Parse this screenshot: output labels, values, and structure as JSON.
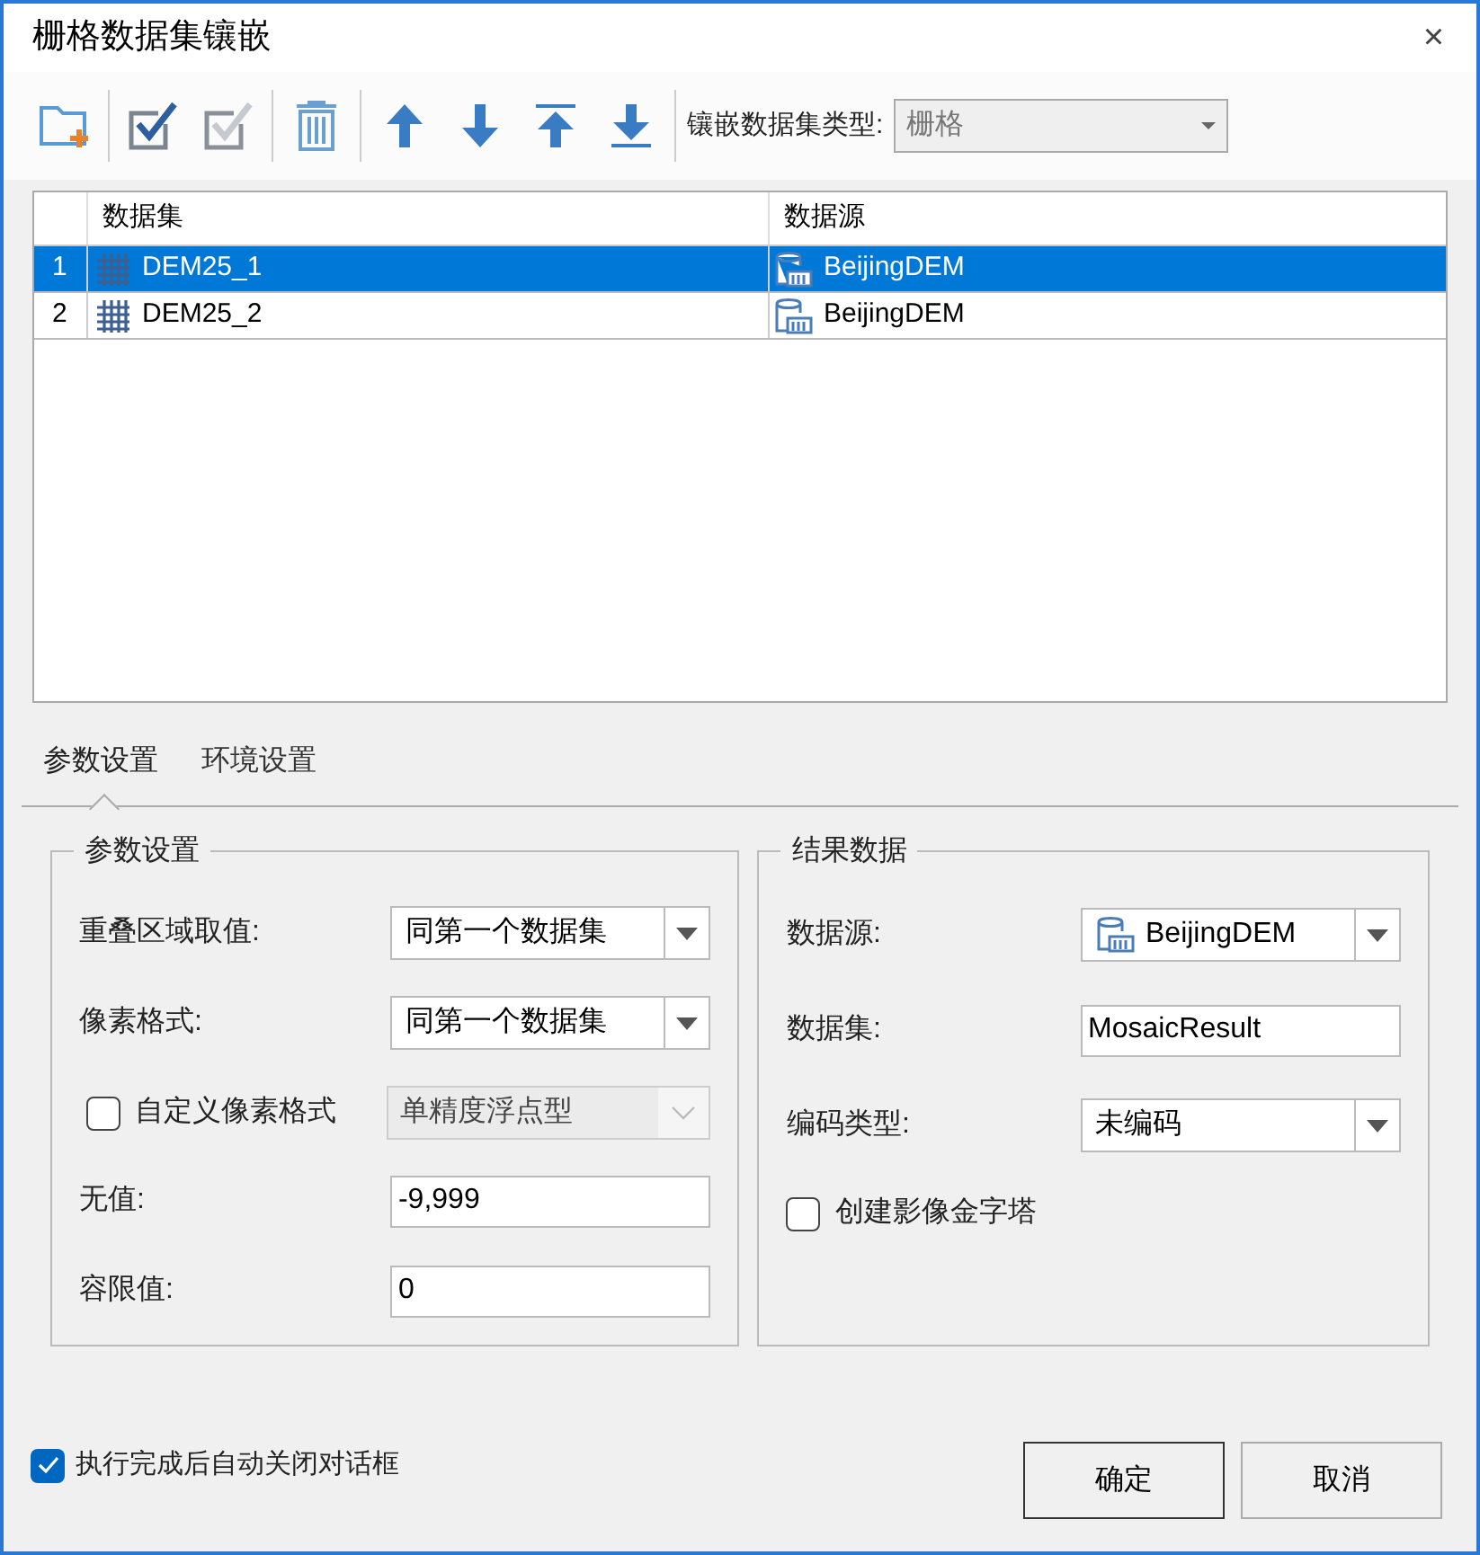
{
  "window": {
    "title": "栅格数据集镶嵌",
    "close": "×"
  },
  "toolbar": {
    "type_label": "镶嵌数据集类型:",
    "type_value": "栅格",
    "type_disabled": true
  },
  "table": {
    "columns": [
      "数据集",
      "数据源"
    ],
    "rows": [
      {
        "index": "1",
        "dataset": "DEM25_1",
        "datasource": "BeijingDEM",
        "selected": true
      },
      {
        "index": "2",
        "dataset": "DEM25_2",
        "datasource": "BeijingDEM",
        "selected": false
      }
    ]
  },
  "tabs": [
    {
      "label": "参数设置",
      "selected": true
    },
    {
      "label": "环境设置",
      "selected": false
    }
  ],
  "params": {
    "title": "参数设置",
    "fields": [
      {
        "kind": "dropdown",
        "label": "重叠区域取值:",
        "value": "同第一个数据集"
      },
      {
        "kind": "dropdown",
        "label": "像素格式:",
        "value": "同第一个数据集"
      },
      {
        "kind": "check_dropdown",
        "label": "自定义像素格式",
        "checked": false,
        "value": "单精度浮点型",
        "disabled": true
      },
      {
        "kind": "input",
        "label": "无值:",
        "value": "-9,999"
      },
      {
        "kind": "input",
        "label": "容限值:",
        "value": "0"
      }
    ]
  },
  "result": {
    "title": "结果数据",
    "fields": [
      {
        "kind": "source_dropdown",
        "label": "数据源:",
        "value": "BeijingDEM"
      },
      {
        "kind": "input",
        "label": "数据集:",
        "value": "MosaicResult"
      },
      {
        "kind": "dropdown",
        "label": "编码类型:",
        "value": "未编码"
      },
      {
        "kind": "checkbox",
        "label": "创建影像金字塔",
        "checked": false
      }
    ]
  },
  "footer": {
    "auto_close": {
      "label": "执行完成后自动关闭对话框",
      "checked": true
    },
    "buttons": [
      {
        "label": "确定",
        "default": true
      },
      {
        "label": "取消",
        "default": false
      }
    ]
  }
}
